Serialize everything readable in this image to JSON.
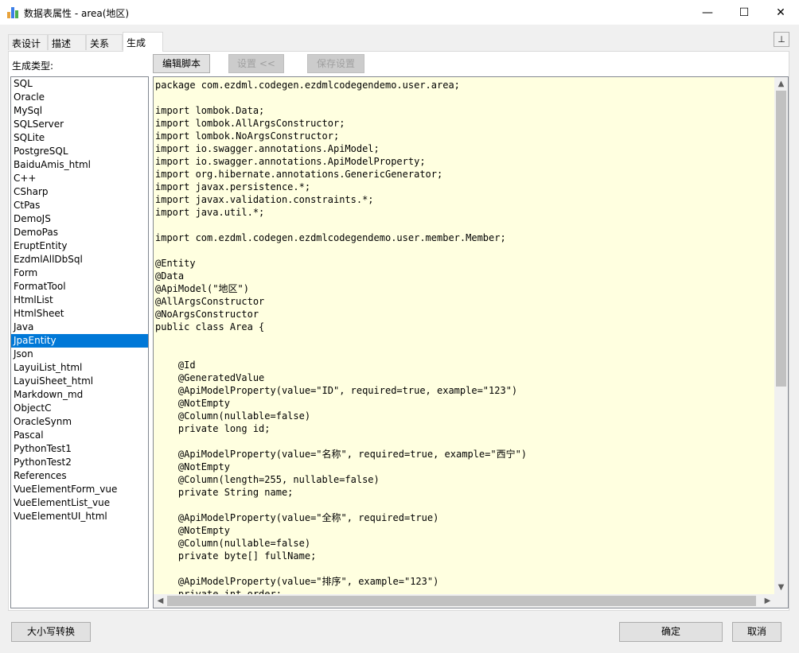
{
  "window": {
    "title": "数据表属性 - area(地区)",
    "minimize_glyph": "—",
    "maximize_glyph": "☐",
    "close_glyph": "✕"
  },
  "tabs": [
    {
      "label": "表设计"
    },
    {
      "label": "描述"
    },
    {
      "label": "关系"
    },
    {
      "label": "生成",
      "active": true
    }
  ],
  "pin_glyph": "⊥",
  "generate": {
    "type_label": "生成类型:",
    "selected": "JpaEntity",
    "types": [
      "SQL",
      "Oracle",
      "MySql",
      "SQLServer",
      "SQLite",
      "PostgreSQL",
      "BaiduAmis_html",
      "C++",
      "CSharp",
      "CtPas",
      "DemoJS",
      "DemoPas",
      "EruptEntity",
      "EzdmlAllDbSql",
      "Form",
      "FormatTool",
      "HtmlList",
      "HtmlSheet",
      "Java",
      "JpaEntity",
      "Json",
      "LayuiList_html",
      "LayuiSheet_html",
      "Markdown_md",
      "ObjectC",
      "OracleSynm",
      "Pascal",
      "PythonTest1",
      "PythonTest2",
      "References",
      "VueElementForm_vue",
      "VueElementList_vue",
      "VueElementUI_html"
    ]
  },
  "toolbar": {
    "edit_script_label": "编辑脚本",
    "settings_label": "设置 <<",
    "save_settings_label": "保存设置"
  },
  "code": "package com.ezdml.codegen.ezdmlcodegendemo.user.area;\n\nimport lombok.Data;\nimport lombok.AllArgsConstructor;\nimport lombok.NoArgsConstructor;\nimport io.swagger.annotations.ApiModel;\nimport io.swagger.annotations.ApiModelProperty;\nimport org.hibernate.annotations.GenericGenerator;\nimport javax.persistence.*;\nimport javax.validation.constraints.*;\nimport java.util.*;\n\nimport com.ezdml.codegen.ezdmlcodegendemo.user.member.Member;\n\n@Entity\n@Data\n@ApiModel(\"地区\")\n@AllArgsConstructor\n@NoArgsConstructor\npublic class Area {\n\n\n    @Id\n    @GeneratedValue\n    @ApiModelProperty(value=\"ID\", required=true, example=\"123\")\n    @NotEmpty\n    @Column(nullable=false)\n    private long id;\n\n    @ApiModelProperty(value=\"名称\", required=true, example=\"西宁\")\n    @NotEmpty\n    @Column(length=255, nullable=false)\n    private String name;\n\n    @ApiModelProperty(value=\"全称\", required=true)\n    @NotEmpty\n    @Column(nullable=false)\n    private byte[] fullName;\n\n    @ApiModelProperty(value=\"排序\", example=\"123\")\n    private int order;",
  "bottom": {
    "case_convert_label": "大小写转换",
    "ok_label": "确定",
    "cancel_label": "取消"
  }
}
